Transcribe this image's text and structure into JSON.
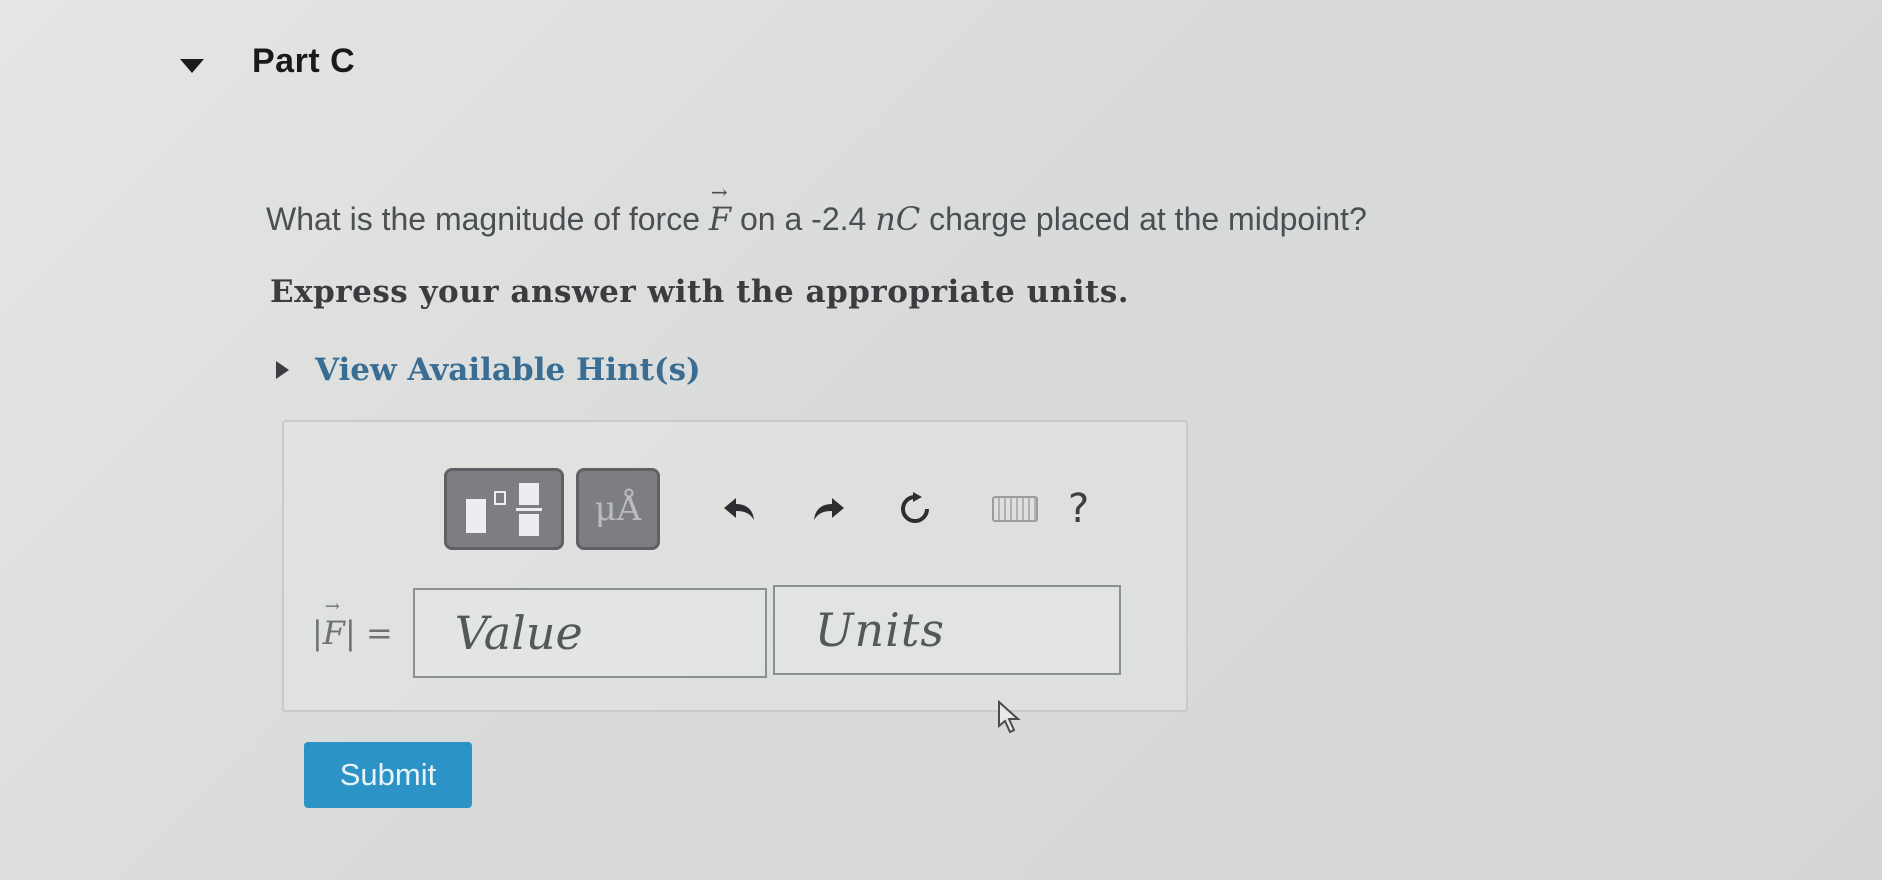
{
  "part": {
    "title": "Part C"
  },
  "question": {
    "prefix": "What is the magnitude of force ",
    "force_symbol": "F",
    "middle": " on a -2.4 ",
    "unit_symbol": "nC",
    "suffix": " charge placed at the midpoint?",
    "instruction": "Express your answer with the appropriate units."
  },
  "hints": {
    "label": "View Available Hint(s)"
  },
  "toolbar": {
    "units_label": "μÅ",
    "help_label": "?"
  },
  "answer": {
    "variable_symbol": "F",
    "equals": "=",
    "value_placeholder": "Value",
    "units_placeholder": "Units"
  },
  "submit": {
    "label": "Submit"
  },
  "colors": {
    "submit_bg": "#2b93c6",
    "hint_link": "#3a6d93",
    "toolbar_btn": "#7c7e81"
  }
}
